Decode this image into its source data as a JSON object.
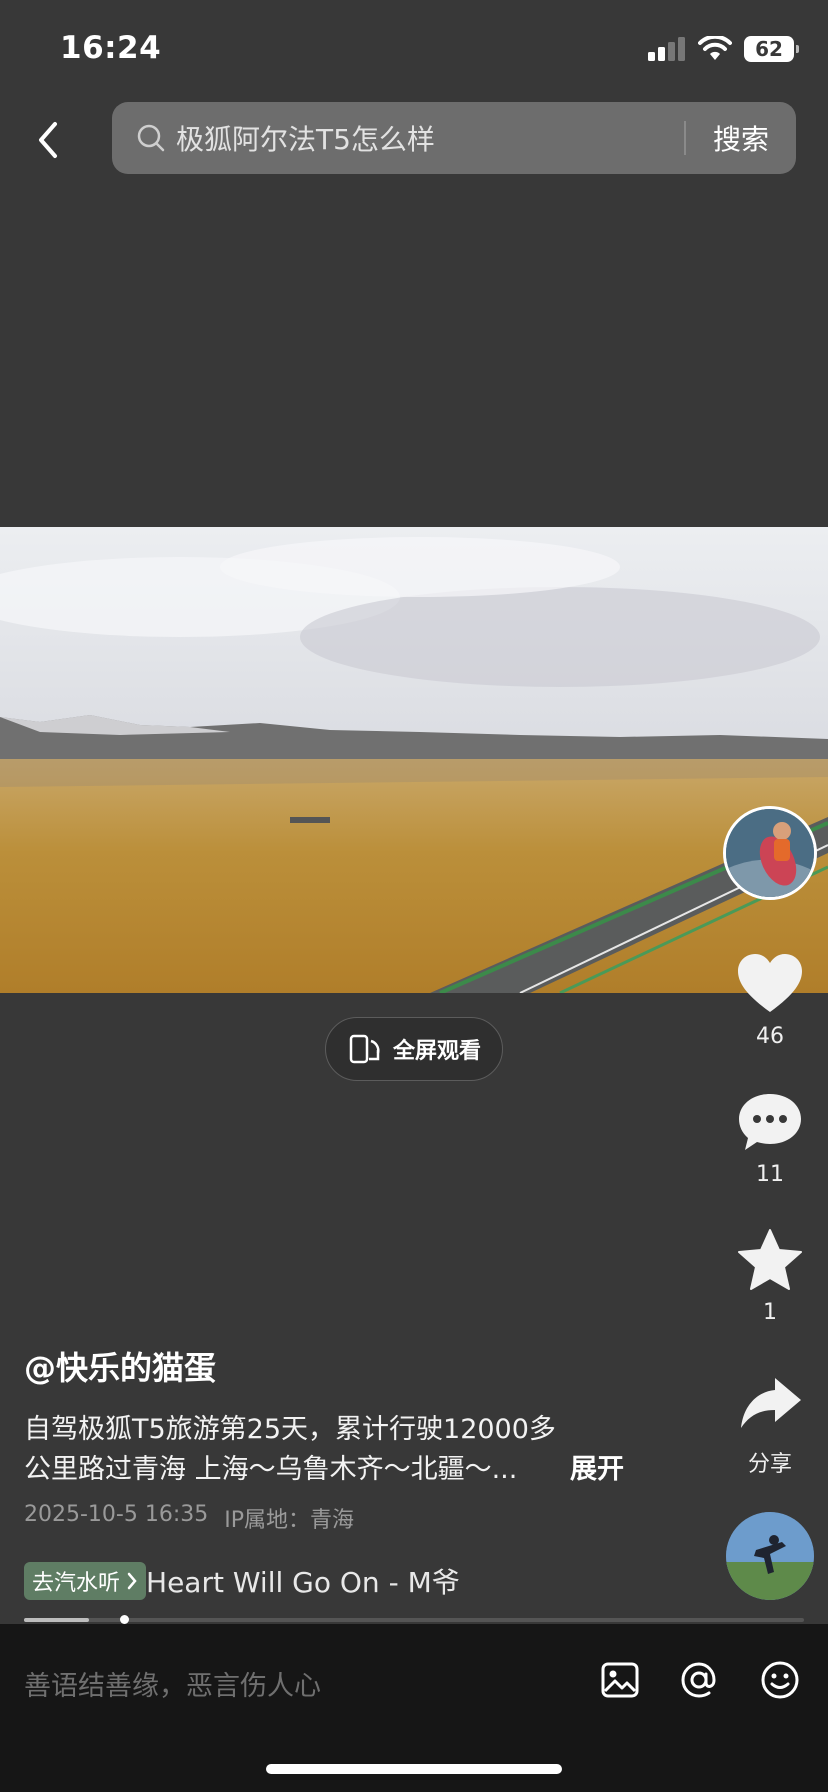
{
  "status_bar": {
    "time": "16:24",
    "battery": "62"
  },
  "header": {
    "search_query": "极狐阿尔法T5怎么样",
    "search_button": "搜索"
  },
  "video": {
    "fullscreen_label": "全屏观看"
  },
  "actions": {
    "likes": "46",
    "comments": "11",
    "favorites": "1",
    "share_label": "分享"
  },
  "post": {
    "author": "@快乐的猫蛋",
    "description_line1": "自驾极狐T5旅游第25天，累计行驶12000多",
    "description_line2": "公里路过青海 上海～乌鲁木齐～北疆～...",
    "expand_label": "展开",
    "date": "2025-10-5 16:35",
    "ip_location": "IP属地：青海"
  },
  "music": {
    "tag_label": "去汽水听",
    "title": "Heart Will Go On - M爷"
  },
  "playback": {
    "progress": 0.083
  },
  "comment_bar": {
    "placeholder": "善语结善缘，恶言伤人心"
  }
}
